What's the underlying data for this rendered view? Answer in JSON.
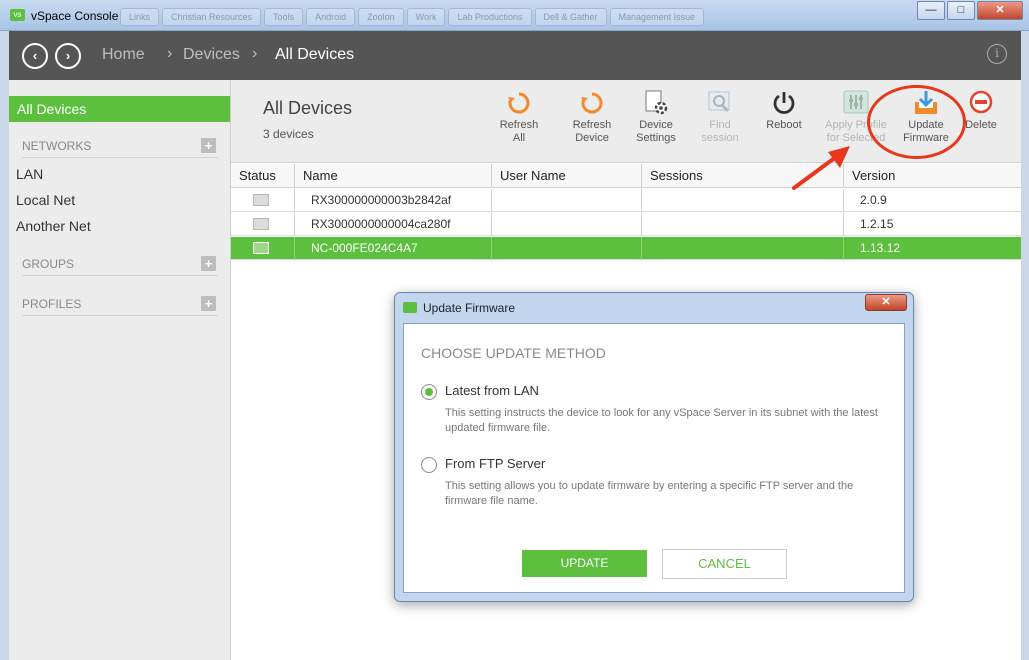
{
  "window": {
    "title": "vSpace Console",
    "logo_text": "vs",
    "bg_tabs": [
      "Links",
      "Christian Resources",
      "Tools",
      "Android",
      "Zoolon",
      "Work",
      "Lab Productions",
      "Dell & Gather",
      "Management Issue"
    ],
    "controls": {
      "minimize": "—",
      "maximize": "□",
      "close": "✕"
    }
  },
  "nav": {
    "back": "‹",
    "forward": "›",
    "breadcrumb": [
      "Home",
      "Devices",
      "All Devices"
    ],
    "separator": "›",
    "info": "i"
  },
  "sidebar": {
    "all_devices": "All Devices",
    "networks_label": "NETWORKS",
    "networks": [
      "LAN",
      "Local Net",
      "Another Net"
    ],
    "groups_label": "GROUPS",
    "profiles_label": "PROFILES",
    "plus": "+"
  },
  "toolbar": {
    "title": "All Devices",
    "count": "3  devices",
    "buttons": [
      {
        "line1": "Refresh",
        "line2": "All",
        "icon": "refresh-icon",
        "enabled": true
      },
      {
        "line1": "Refresh",
        "line2": "Device",
        "icon": "refresh-icon",
        "enabled": true
      },
      {
        "line1": "Device",
        "line2": "Settings",
        "icon": "gear-icon",
        "enabled": true
      },
      {
        "line1": "Find",
        "line2": "session",
        "icon": "find-icon",
        "enabled": false
      },
      {
        "line1": "Reboot",
        "line2": "",
        "icon": "power-icon",
        "enabled": true
      },
      {
        "line1": "Apply Profile",
        "line2": "for Selected",
        "icon": "sliders-icon",
        "enabled": false
      },
      {
        "line1": "Update",
        "line2": "Firmware",
        "icon": "download-icon",
        "enabled": true
      },
      {
        "line1": "Delete",
        "line2": "",
        "icon": "delete-icon",
        "enabled": true
      }
    ]
  },
  "table": {
    "columns": [
      "Status",
      "Name",
      "User Name",
      "Sessions",
      "Version"
    ],
    "rows": [
      {
        "name": "RX300000000003b2842af",
        "user": "",
        "sessions": "",
        "version": "2.0.9",
        "selected": false
      },
      {
        "name": "RX3000000000004ca280f",
        "user": "",
        "sessions": "",
        "version": "1.2.15",
        "selected": false
      },
      {
        "name": "NC-000FE024C4A7",
        "user": "",
        "sessions": "",
        "version": "1.13.12",
        "selected": true
      }
    ]
  },
  "dialog": {
    "title": "Update Firmware",
    "close": "✕",
    "heading": "CHOOSE UPDATE METHOD",
    "options": [
      {
        "label": "Latest from LAN",
        "desc": "This setting instructs the device to look for any vSpace Server in its subnet with the latest updated firmware file.",
        "checked": true
      },
      {
        "label": "From FTP Server",
        "desc": "This setting allows you to update firmware by entering a specific FTP server and the firmware file name.",
        "checked": false
      }
    ],
    "update_label": "UPDATE",
    "cancel_label": "CANCEL"
  },
  "colors": {
    "accent": "#5cbf3d",
    "annotation": "#e8371b",
    "header": "#555555"
  }
}
